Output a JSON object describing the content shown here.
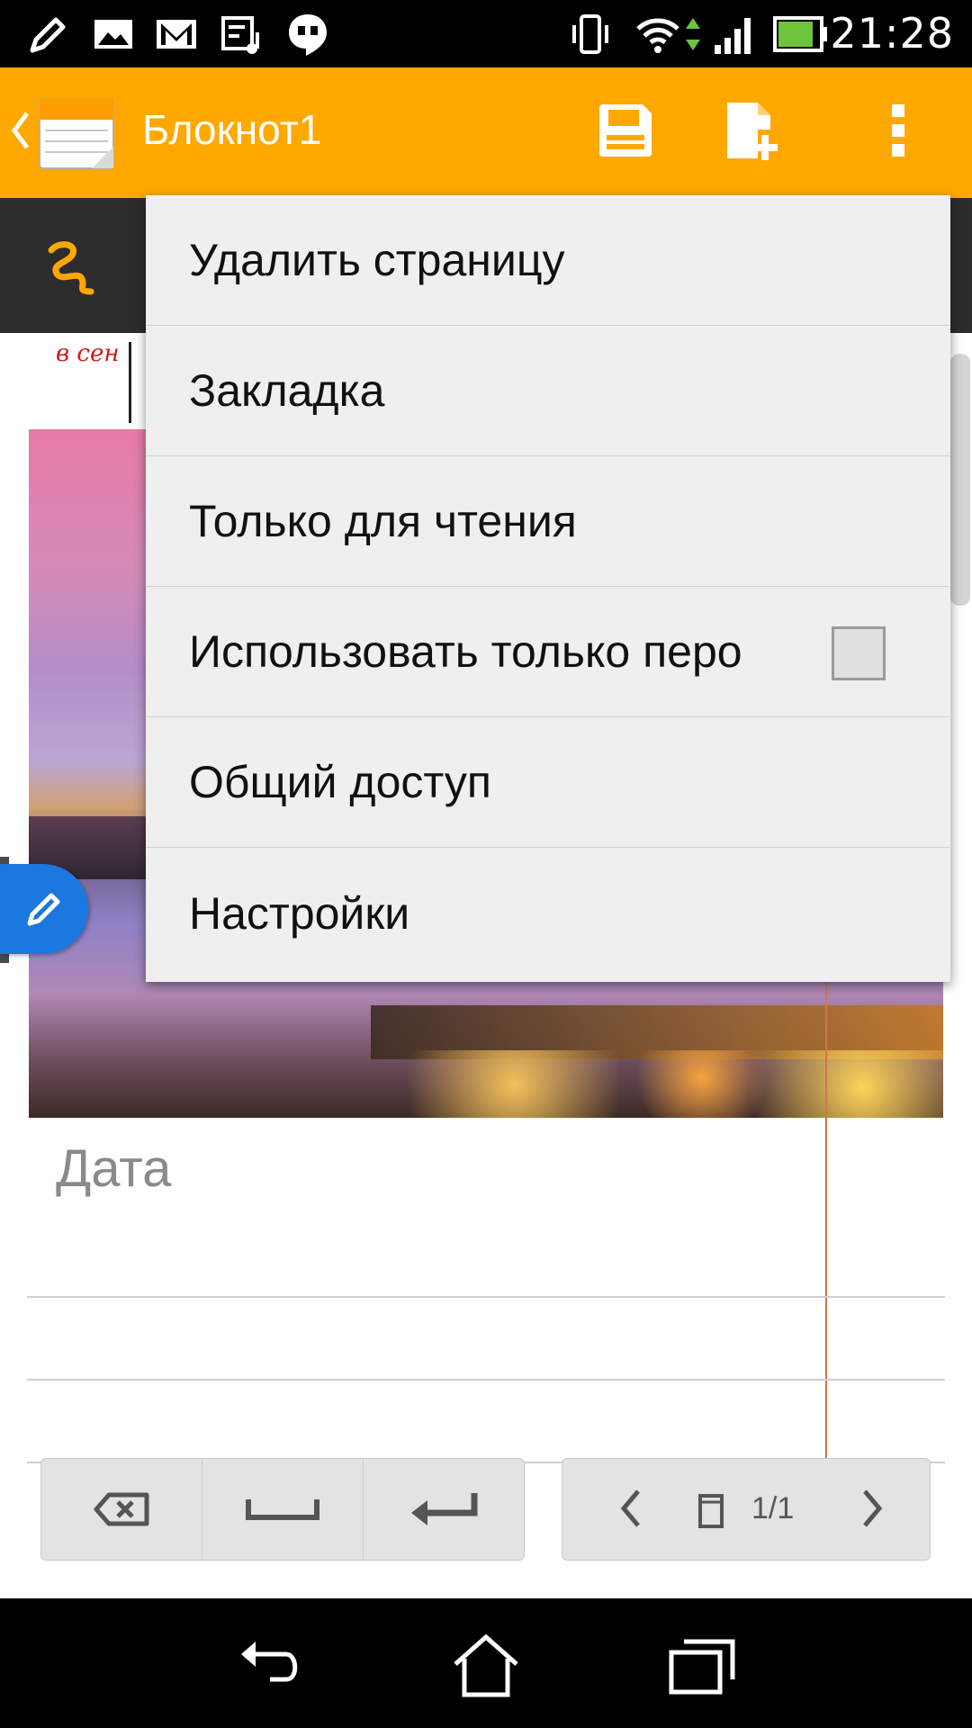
{
  "status_bar": {
    "time": "21:28",
    "icons": [
      "pencil-icon",
      "image-icon",
      "gmail-icon",
      "music-playlist-icon",
      "hangouts-icon",
      "vibrate-icon",
      "wifi-icon",
      "signal-icon",
      "battery-icon"
    ]
  },
  "action_bar": {
    "title": "Блокнот1",
    "icons": [
      "back-chevron-icon",
      "notebook-logo-icon",
      "save-icon",
      "new-page-icon",
      "overflow-menu-icon"
    ],
    "color": "#ffa800"
  },
  "page": {
    "handwriting": "в сен",
    "date_label": "Дата"
  },
  "menu": {
    "items": [
      {
        "label": "Удалить страницу"
      },
      {
        "label": "Закладка"
      },
      {
        "label": "Только для чтения"
      },
      {
        "label": "Использовать только перо",
        "checked": false
      },
      {
        "label": "Общий доступ"
      },
      {
        "label": "Настройки"
      }
    ]
  },
  "edit_keys": [
    "backspace-icon",
    "space-icon",
    "enter-icon"
  ],
  "pager": {
    "page_count": "1/1"
  },
  "nav_bar": [
    "back-icon",
    "home-icon",
    "recents-icon"
  ]
}
